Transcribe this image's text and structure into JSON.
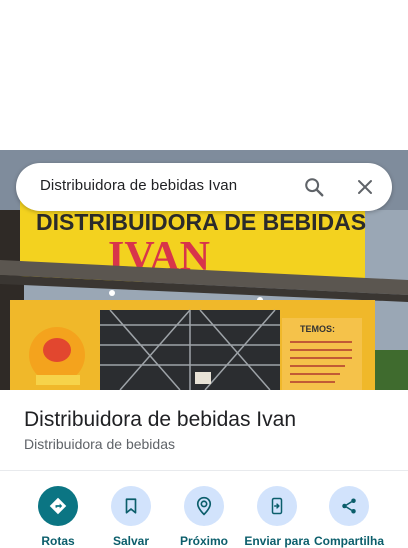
{
  "search": {
    "query": "Distribuidora de bebidas Ivan",
    "search_icon": "search-icon",
    "clear_icon": "close-icon"
  },
  "photo": {
    "sign_line1": "DISTRIBUIDORA DE BEBIDAS",
    "sign_line2": "IVAN",
    "menu_title": "TEMOS:"
  },
  "place": {
    "title": "Distribuidora de bebidas Ivan",
    "category": "Distribuidora de bebidas"
  },
  "actions": [
    {
      "label": "Rotas",
      "icon": "directions-icon"
    },
    {
      "label": "Salvar",
      "icon": "bookmark-icon"
    },
    {
      "label": "Próximo",
      "icon": "nearby-icon"
    },
    {
      "label": "Enviar para",
      "icon": "send-to-phone-icon"
    },
    {
      "label": "Compartilha",
      "icon": "share-icon"
    }
  ],
  "colors": {
    "primary_action": "#0b7583",
    "action_bg": "#d2e3fc",
    "sign_yellow": "#f3d21f",
    "sign_red": "#d8354a"
  }
}
